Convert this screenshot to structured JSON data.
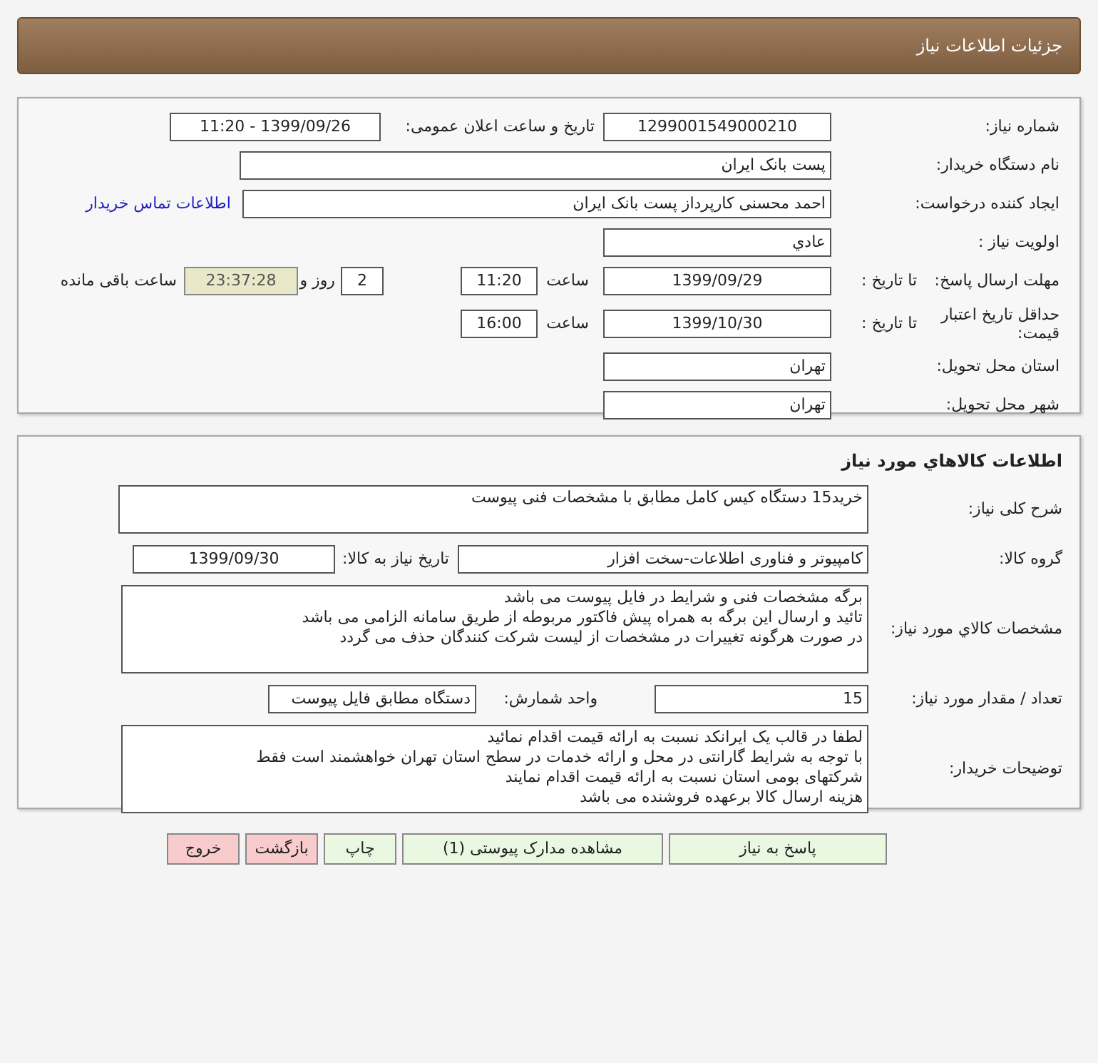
{
  "header": {
    "title": "جزئیات اطلاعات نیاز"
  },
  "need_info": {
    "need_number": {
      "label": "شماره نیاز:",
      "value": "1299001549000210"
    },
    "announce": {
      "label": "تاریخ و ساعت اعلان عمومی:",
      "value": "1399/09/26 - 11:20"
    },
    "buyer_org": {
      "label": "نام دستگاه خریدار:",
      "value": "پست بانک ایران"
    },
    "requester": {
      "label": "ایجاد کننده درخواست:",
      "value": "احمد  محسنی کارپرداز پست بانک ایران",
      "link": "اطلاعات تماس خریدار"
    },
    "priority": {
      "label": "اولویت نیاز :",
      "value": "عادي"
    },
    "reply_deadline": {
      "label": "مهلت ارسال پاسخ:",
      "to_label": "تا تاریخ :",
      "date": "1399/09/29",
      "time_label": "ساعت",
      "time": "11:20",
      "days": "2",
      "days_suffix": "روز و",
      "remaining": "23:37:28",
      "remaining_suffix": "ساعت باقی مانده"
    },
    "price_validity": {
      "label": "حداقل تاریخ اعتبار قیمت:",
      "to_label": "تا تاریخ :",
      "date": "1399/10/30",
      "time_label": "ساعت",
      "time": "16:00"
    },
    "province": {
      "label": "استان محل تحویل:",
      "value": "تهران"
    },
    "city": {
      "label": "شهر محل تحویل:",
      "value": "تهران"
    }
  },
  "goods": {
    "title": "اطلاعات کالاهاي مورد نیاز",
    "description": {
      "label": "شرح کلی نیاز:",
      "value": "خرید15 دستگاه کیس کامل مطابق با مشخصات فنی پیوست"
    },
    "group": {
      "label": "گروه کالا:",
      "value": "کامپیوتر و فناوری اطلاعات-سخت افزار"
    },
    "need_date": {
      "label": "تاریخ نیاز به کالا:",
      "value": "1399/09/30"
    },
    "specs": {
      "label": "مشخصات کالاي مورد نیاز:",
      "lines": [
        "برگه مشخصات فنی و شرایط در فایل پیوست می باشد",
        "تائید و ارسال این برگه به همراه پیش فاکتور مربوطه از طریق سامانه الزامی می باشد",
        "در صورت هرگونه تغییرات در مشخصات از لیست شرکت کنندگان حذف می گردد"
      ]
    },
    "quantity": {
      "label": "تعداد / مقدار مورد نیاز:",
      "value": "15"
    },
    "unit": {
      "label": "واحد شمارش:",
      "value": "دستگاه مطابق فایل پیوست"
    },
    "notes": {
      "label": "توضیحات خریدار:",
      "lines": [
        "لطفا در قالب یک ایرانکد نسبت به ارائه قیمت اقدام نمائید",
        "با توجه به شرایط گارانتی در محل و ارائه خدمات در سطح استان تهران خواهشمند است فقط",
        "شرکتهای بومی استان نسبت به ارائه قیمت اقدام نمایند",
        "هزینه ارسال کالا برعهده فروشنده می باشد"
      ]
    }
  },
  "buttons": [
    {
      "label": "پاسخ به نیاز",
      "kind": "green"
    },
    {
      "label": "مشاهده مدارک پیوستی (1)",
      "kind": "green"
    },
    {
      "label": "چاپ",
      "kind": "green"
    },
    {
      "label": "بازگشت",
      "kind": "red"
    },
    {
      "label": "خروج",
      "kind": "red"
    }
  ]
}
